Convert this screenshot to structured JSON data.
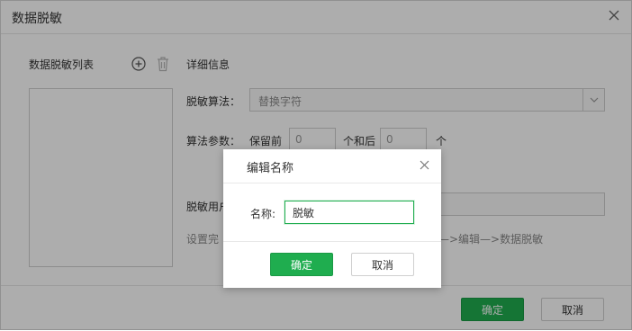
{
  "main": {
    "title": "数据脱敏",
    "list_label": "数据脱敏列表",
    "detail_title": "详细信息",
    "algorithm_label": "脱敏算法：",
    "algorithm_value": "替换字符",
    "params_label": "算法参数：",
    "keep_before_label": "保留前",
    "keep_before_value": "0",
    "and_after_label": "个和后",
    "keep_after_value": "0",
    "unit_label": "个",
    "users_label": "脱敏用户",
    "hint_left": "设置完",
    "hint_right": "—>编辑—>数据脱敏",
    "confirm_label": "确定",
    "cancel_label": "取消"
  },
  "modal": {
    "title": "编辑名称",
    "name_label": "名称:",
    "name_value": "脱敏",
    "confirm_label": "确定",
    "cancel_label": "取消"
  },
  "colors": {
    "accent": "#1fad4f",
    "overlay": "rgba(0,0,0,0.32)"
  },
  "icons": {
    "close": "close-icon",
    "add": "plus-circle-icon",
    "delete": "trash-icon",
    "dropdown": "chevron-down-icon"
  }
}
